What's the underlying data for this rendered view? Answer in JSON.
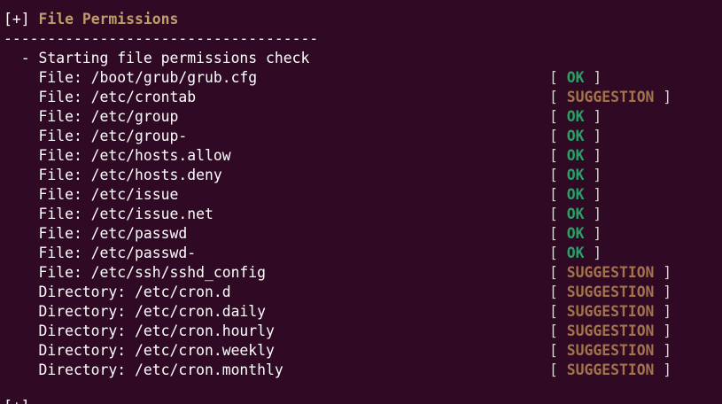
{
  "header": {
    "prefix": "[+]",
    "title": "File Permissions",
    "separator": "------------------------------------"
  },
  "intro": "  - Starting file permissions check",
  "checks": [
    {
      "label": "    File: /boot/grub/grub.cfg",
      "status": "OK"
    },
    {
      "label": "    File: /etc/crontab",
      "status": "SUGGESTION"
    },
    {
      "label": "    File: /etc/group",
      "status": "OK"
    },
    {
      "label": "    File: /etc/group-",
      "status": "OK"
    },
    {
      "label": "    File: /etc/hosts.allow",
      "status": "OK"
    },
    {
      "label": "    File: /etc/hosts.deny",
      "status": "OK"
    },
    {
      "label": "    File: /etc/issue",
      "status": "OK"
    },
    {
      "label": "    File: /etc/issue.net",
      "status": "OK"
    },
    {
      "label": "    File: /etc/passwd",
      "status": "OK"
    },
    {
      "label": "    File: /etc/passwd-",
      "status": "OK"
    },
    {
      "label": "    File: /etc/ssh/sshd_config",
      "status": "SUGGESTION"
    },
    {
      "label": "    Directory: /etc/cron.d",
      "status": "SUGGESTION"
    },
    {
      "label": "    Directory: /etc/cron.daily",
      "status": "SUGGESTION"
    },
    {
      "label": "    Directory: /etc/cron.hourly",
      "status": "SUGGESTION"
    },
    {
      "label": "    Directory: /etc/cron.weekly",
      "status": "SUGGESTION"
    },
    {
      "label": "    Directory: /etc/cron.monthly",
      "status": "SUGGESTION"
    }
  ],
  "bracket_open": "[ ",
  "bracket_close": " ]",
  "colors": {
    "background": "#300a24",
    "ok": "#26a269",
    "suggestion": "#a2734c",
    "header": "#c19c6b",
    "text": "#ffffff"
  }
}
